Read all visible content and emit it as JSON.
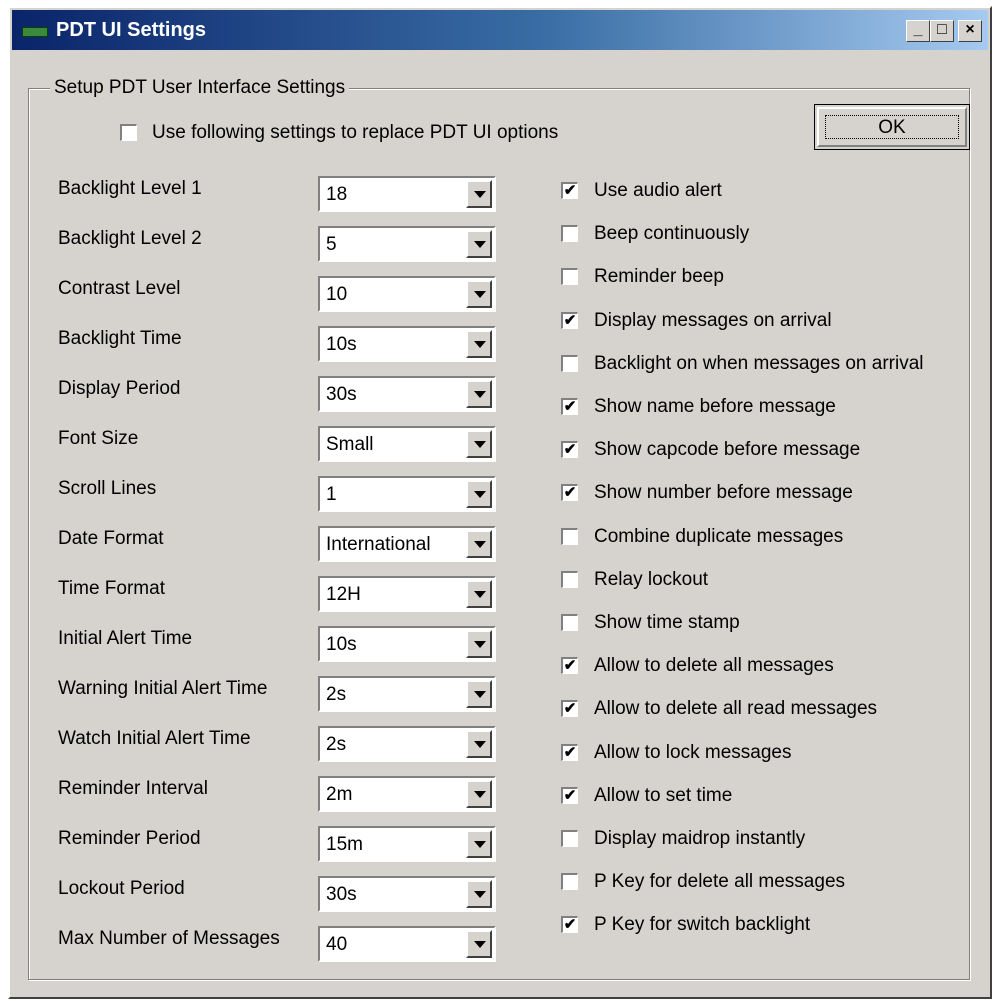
{
  "window": {
    "title": "PDT UI Settings",
    "min": "_",
    "max": "□",
    "close": "×"
  },
  "group": {
    "label": "Setup PDT User Interface Settings"
  },
  "replace_option": {
    "label": "Use following settings to replace PDT UI options",
    "checked": false
  },
  "ok_label": "OK",
  "settings": [
    {
      "label": "Backlight Level 1",
      "value": "18"
    },
    {
      "label": "Backlight Level 2",
      "value": "5"
    },
    {
      "label": "Contrast Level",
      "value": "10"
    },
    {
      "label": "Backlight Time",
      "value": "10s"
    },
    {
      "label": "Display Period",
      "value": "30s"
    },
    {
      "label": "Font Size",
      "value": "Small"
    },
    {
      "label": "Scroll Lines",
      "value": "1"
    },
    {
      "label": "Date Format",
      "value": "International"
    },
    {
      "label": "Time Format",
      "value": "12H"
    },
    {
      "label": "Initial Alert Time",
      "value": "10s"
    },
    {
      "label": "Warning Initial Alert Time",
      "value": "2s"
    },
    {
      "label": "Watch Initial Alert Time",
      "value": "2s"
    },
    {
      "label": "Reminder Interval",
      "value": "2m"
    },
    {
      "label": "Reminder Period",
      "value": "15m"
    },
    {
      "label": "Lockout Period",
      "value": "30s"
    },
    {
      "label": "Max Number of Messages",
      "value": "40"
    }
  ],
  "options": [
    {
      "label": "Use audio alert",
      "checked": true
    },
    {
      "label": "Beep continuously",
      "checked": false
    },
    {
      "label": "Reminder beep",
      "checked": false
    },
    {
      "label": "Display messages on arrival",
      "checked": true
    },
    {
      "label": "Backlight on when messages on arrival",
      "checked": false
    },
    {
      "label": "Show name before message",
      "checked": true
    },
    {
      "label": "Show capcode before message",
      "checked": true
    },
    {
      "label": "Show number before message",
      "checked": true
    },
    {
      "label": "Combine duplicate messages",
      "checked": false
    },
    {
      "label": "Relay lockout",
      "checked": false
    },
    {
      "label": "Show time stamp",
      "checked": false
    },
    {
      "label": "Allow to delete all messages",
      "checked": true
    },
    {
      "label": "Allow to delete all read messages",
      "checked": true
    },
    {
      "label": "Allow to lock messages",
      "checked": true
    },
    {
      "label": "Allow to set time",
      "checked": true
    },
    {
      "label": "Display maidrop instantly",
      "checked": false
    },
    {
      "label": "P Key for delete all messages",
      "checked": false
    },
    {
      "label": "P Key for switch backlight",
      "checked": true
    }
  ]
}
